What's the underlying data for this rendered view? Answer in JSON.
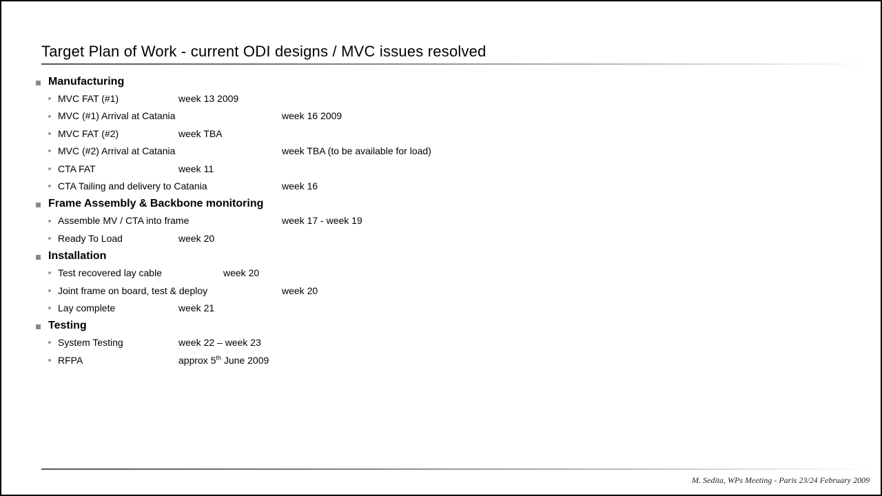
{
  "title": "Target Plan of Work - current ODI designs / MVC issues resolved",
  "footer": "M. Sedita, WPs Meeting - Paris 23/24 February 2009",
  "sections": [
    {
      "title": "Manufacturing",
      "items": [
        {
          "label": "MVC FAT (#1)",
          "when": "week 13 2009",
          "col": "a"
        },
        {
          "label": "MVC (#1) Arrival at Catania",
          "when": "week 16 2009",
          "col": "b"
        },
        {
          "label": "MVC FAT (#2)",
          "when": "week TBA",
          "col": "a"
        },
        {
          "label": "MVC (#2) Arrival at Catania",
          "when": "week TBA (to be available for load)",
          "col": "b"
        },
        {
          "label": "CTA FAT",
          "when": "week 11",
          "col": "a"
        },
        {
          "label": "CTA Tailing and delivery to Catania",
          "when": "week 16",
          "col": "b"
        }
      ]
    },
    {
      "title": "Frame Assembly & Backbone monitoring",
      "items": [
        {
          "label": "Assemble MV / CTA into frame",
          "when": "week 17 - week 19",
          "col": "b"
        },
        {
          "label": "Ready To Load",
          "when": "week 20",
          "col": "a"
        }
      ]
    },
    {
      "title": "Installation",
      "items": [
        {
          "label": "Test recovered lay cable",
          "when": "week 20",
          "col": "c"
        },
        {
          "label": "Joint frame on board, test & deploy",
          "when": "week 20",
          "col": "b"
        },
        {
          "label": "Lay complete",
          "when": "week 21",
          "col": "a"
        }
      ]
    },
    {
      "title": "Testing",
      "items": [
        {
          "label": "System Testing",
          "when": "week 22 – week 23",
          "col": "a"
        },
        {
          "label": "RFPA",
          "when": "approx 5th June 2009",
          "col": "a",
          "ordinal": "th",
          "when_pre": "approx 5",
          "when_post": " June 2009"
        }
      ]
    }
  ]
}
